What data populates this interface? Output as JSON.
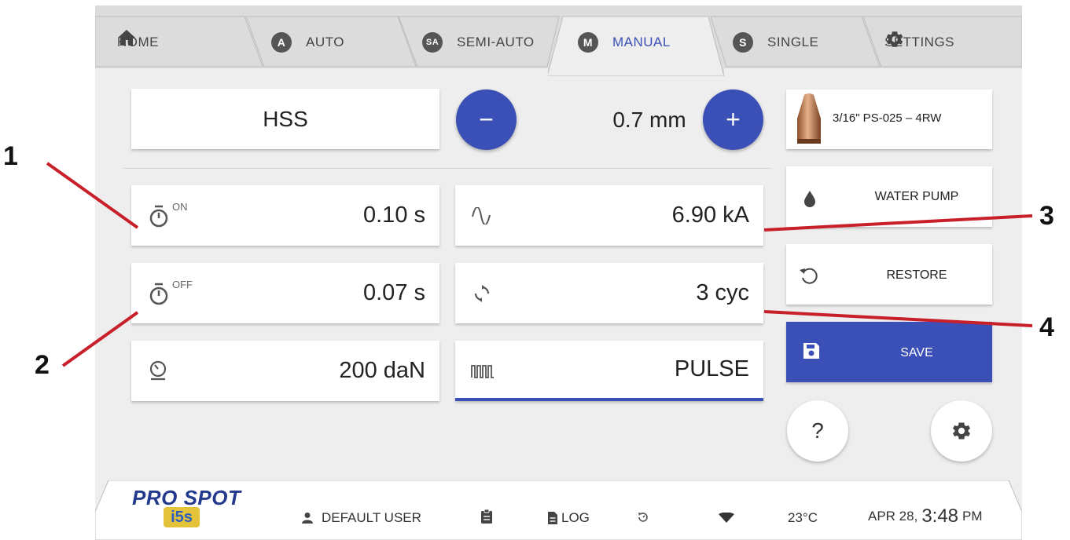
{
  "tabs": [
    {
      "label": "HOME",
      "icon": "home-icon"
    },
    {
      "label": "AUTO",
      "badge": "A"
    },
    {
      "label": "SEMI-AUTO",
      "badge": "SA"
    },
    {
      "label": "MANUAL",
      "badge": "M",
      "active": true
    },
    {
      "label": "SINGLE",
      "badge": "S"
    },
    {
      "label": "SETTINGS",
      "icon": "gear-icon"
    }
  ],
  "main": {
    "material": "HSS",
    "thickness": "0.7 mm",
    "decrease_label": "−",
    "increase_label": "+",
    "time_on": {
      "sup": "ON",
      "value": "0.10 s"
    },
    "time_off": {
      "sup": "OFF",
      "value": "0.07 s"
    },
    "force": {
      "value": "200 daN"
    },
    "current": {
      "value": "6.90 kA"
    },
    "cycles": {
      "value": "3 cyc"
    },
    "mode": {
      "value": "PULSE"
    }
  },
  "side": {
    "electrode": "3/16\" PS-025 – 4RW",
    "water_pump": "WATER PUMP",
    "restore": "RESTORE",
    "save": "SAVE",
    "help": "?"
  },
  "footer": {
    "brand": "PRO SPOT",
    "model": "i5s",
    "user": "DEFAULT USER",
    "log": "LOG",
    "temperature": "23°C",
    "date": "APR 28,",
    "time": "3:48",
    "ampm": "PM"
  },
  "annotations": [
    "1",
    "2",
    "3",
    "4"
  ],
  "colors": {
    "accent": "#3a50b6",
    "callout": "#c8202a",
    "background": "#eeeeee"
  }
}
